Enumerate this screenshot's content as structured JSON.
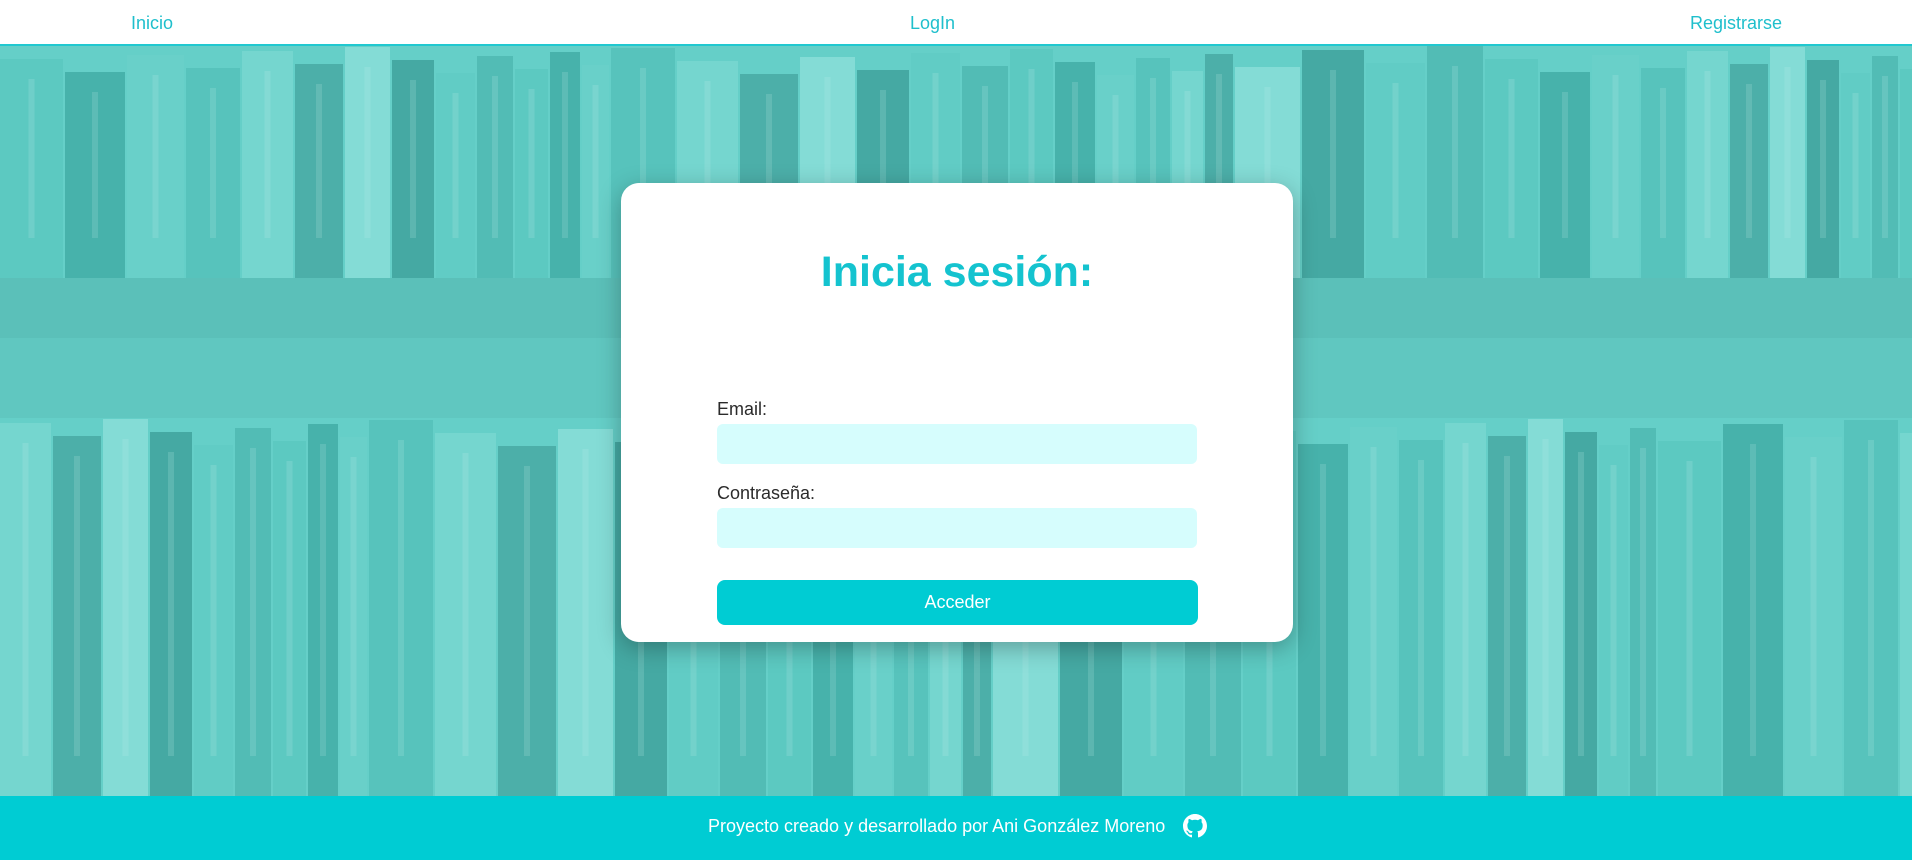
{
  "nav": {
    "home": "Inicio",
    "login": "LogIn",
    "register": "Registrarse"
  },
  "login_card": {
    "title": "Inicia sesión:",
    "email_label": "Email:",
    "email_value": "",
    "password_label": "Contraseña:",
    "password_value": "",
    "submit_label": "Acceder"
  },
  "footer": {
    "credit": "Proyecto creado y desarrollado por Ani González Moreno",
    "icon": "github-icon"
  },
  "colors": {
    "accent": "#00ccd3",
    "nav_text": "#1fbfcc",
    "input_bg": "#d6fdfd",
    "title": "#14c3cf"
  },
  "background": {
    "icon": "bookshelf-image"
  }
}
